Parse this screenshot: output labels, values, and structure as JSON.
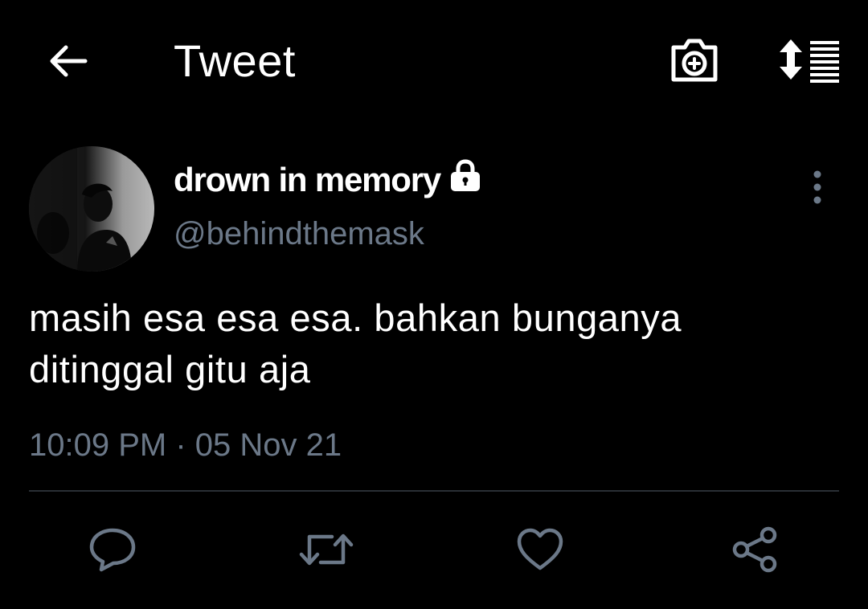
{
  "header": {
    "title": "Tweet",
    "back_icon": "arrow-left-icon",
    "camera_icon": "camera-plus-icon",
    "sort_icon": "sort-lines-icon"
  },
  "tweet": {
    "author": {
      "display_name": "drown in memory",
      "handle": "@behindthemask",
      "protected_icon": "lock-icon",
      "avatar_icon": "avatar-photo"
    },
    "text_lines": [
      "masih esa esa esa. bahkan bunganya",
      "ditinggal gitu aja"
    ],
    "time": "10:09 PM",
    "separator": "·",
    "date": "05 Nov 21"
  },
  "actions": {
    "reply_icon": "reply-icon",
    "retweet_icon": "retweet-icon",
    "like_icon": "heart-icon",
    "share_icon": "share-icon"
  },
  "colors": {
    "background": "#000000",
    "text_primary": "#ffffff",
    "text_secondary": "#6b7888",
    "divider": "#2a2f35"
  }
}
